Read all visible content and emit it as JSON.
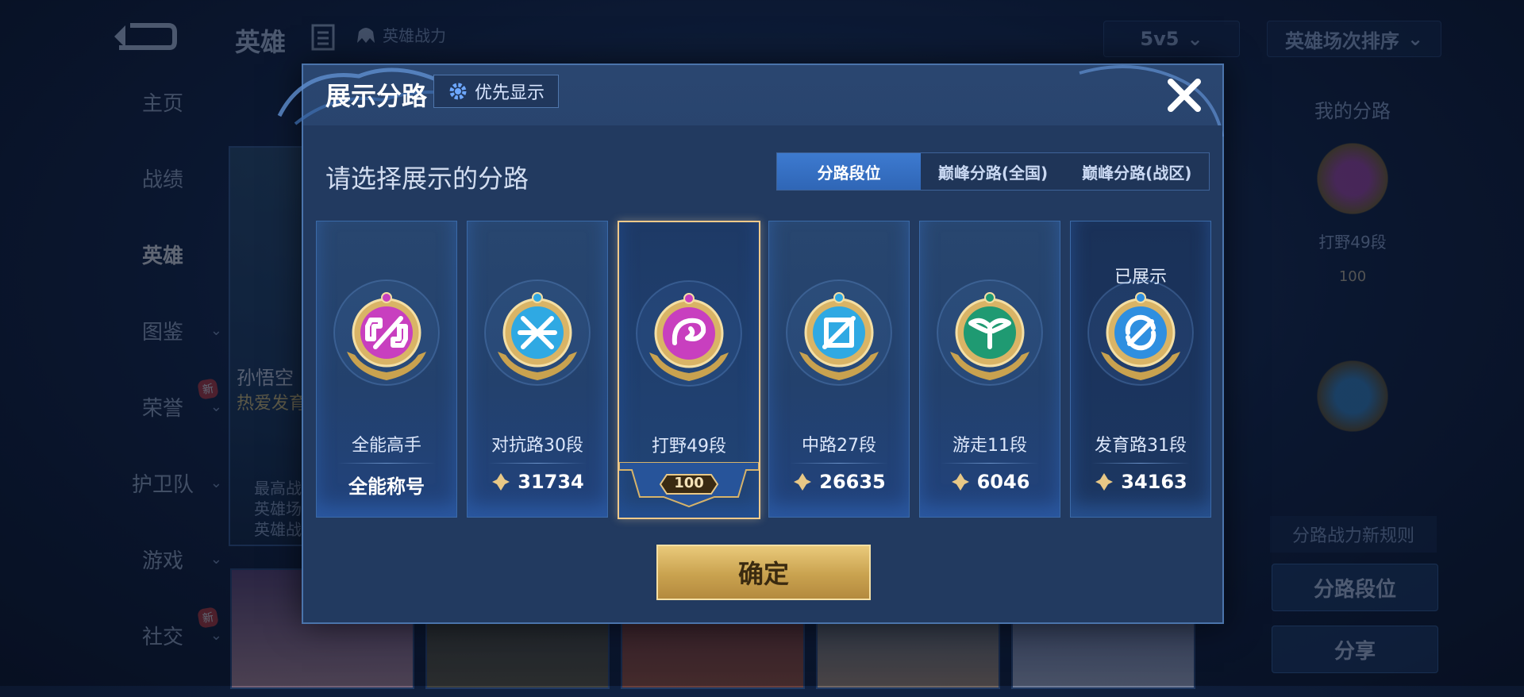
{
  "background": {
    "title": "英雄",
    "power_label": "英雄战力",
    "mode_select": "5v5",
    "sort_select": "英雄场次排序",
    "sidebar": [
      {
        "label": "主页"
      },
      {
        "label": "战绩"
      },
      {
        "label": "英雄"
      },
      {
        "label": "图鉴"
      },
      {
        "label": "荣誉",
        "badge": "新"
      },
      {
        "label": "护卫队"
      },
      {
        "label": "游戏"
      },
      {
        "label": "社交",
        "badge": "新"
      }
    ],
    "hero_card": {
      "name": "孙悟空",
      "subtitle": "热爱发育",
      "stats": [
        "最高战",
        "英雄场",
        "英雄战"
      ]
    },
    "right_panel": {
      "title": "我的分路",
      "badge_label": "打野49段",
      "badge_level": "100",
      "rule_text": "分路战力新规则",
      "btn_lane_rank": "分路段位",
      "btn_share": "分享"
    }
  },
  "modal": {
    "title": "展示分路",
    "priority_label": "优先显示",
    "subtitle": "请选择展示的分路",
    "tabs": [
      {
        "label": "分路段位",
        "active": true
      },
      {
        "label": "巅峰分路(全国)",
        "active": false
      },
      {
        "label": "巅峰分路(战区)",
        "active": false
      }
    ],
    "cards": [
      {
        "name": "全能高手",
        "value": "全能称号",
        "color": "#c83fbf",
        "icon": "all-round-icon"
      },
      {
        "name": "对抗路30段",
        "value": "31734",
        "color": "#2fa9e3",
        "icon": "swords-icon"
      },
      {
        "name": "打野49段",
        "value": "100",
        "color": "#c83fbf",
        "icon": "dragon-icon",
        "selected": true
      },
      {
        "name": "中路27段",
        "value": "26635",
        "color": "#2fa9e3",
        "icon": "wand-icon"
      },
      {
        "name": "游走11段",
        "value": "6046",
        "color": "#1f9a72",
        "icon": "wings-icon"
      },
      {
        "name": "发育路31段",
        "value": "34163",
        "color": "#2f8fe0",
        "icon": "arrow-circle-icon",
        "shown": "已展示"
      }
    ],
    "confirm_label": "确定"
  }
}
